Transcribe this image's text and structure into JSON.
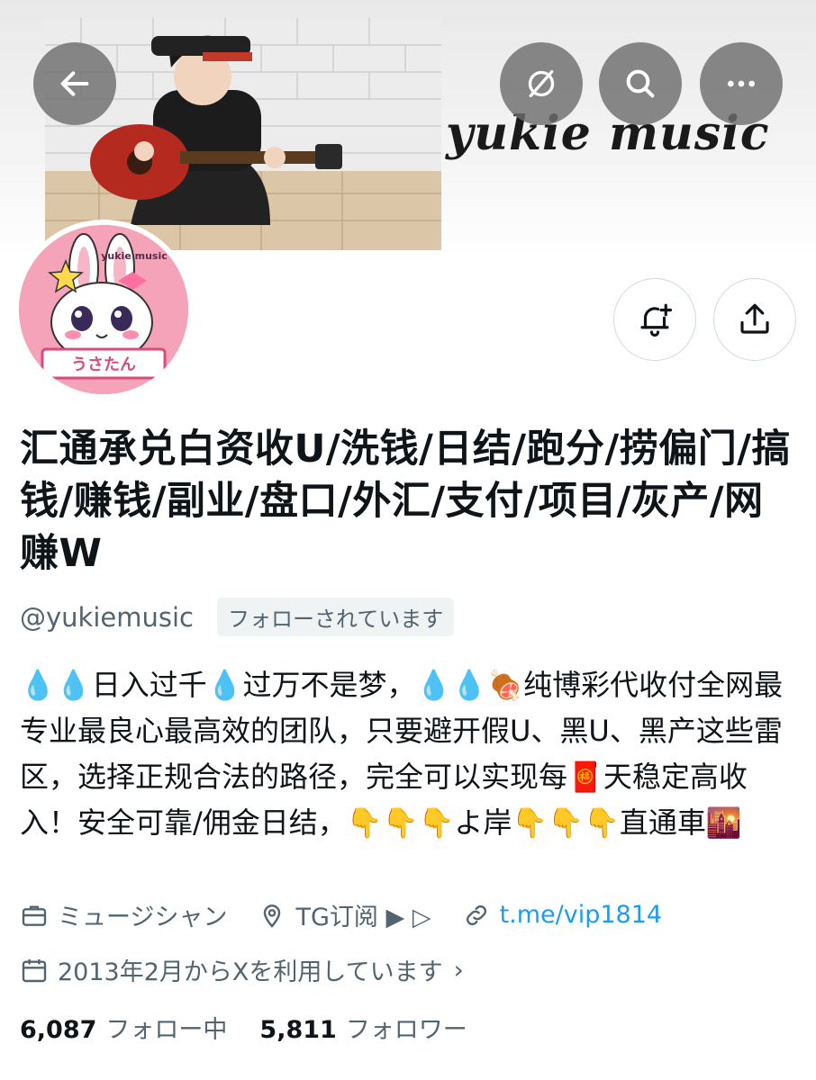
{
  "header": {
    "banner_text": "yukie music",
    "avatar_text_top": "yukie music",
    "avatar_text_bottom": "うさたん"
  },
  "profile": {
    "display_name": "汇通承兑白资收U/洗钱/日结/跑分/捞偏门/搞钱/赚钱/副业/盘口/外汇/支付/项目/灰产/网赚W",
    "handle": "@yukiemusic",
    "follows_you": "フォローされています",
    "bio": "💧💧日入过千💧过万不是梦，💧💧🍖纯博彩代收付全网最专业最良心最高效的团队，只要避开假U、黑U、黑产这些雷区，选择正规合法的路径，完全可以实现每🧧天稳定高收入！安全可靠/佣金日结，👇👇👇よ岸👇👇👇直通車🌇",
    "category": "ミュージシャン",
    "location": "TG订阅 ▶︎ ▷",
    "link": "t.me/vip1814",
    "joined": "2013年2月からXを利用しています",
    "following_count": "6,087",
    "following_label": "フォロー中",
    "followers_count": "5,811",
    "followers_label": "フォロワー"
  },
  "icons": {
    "back": "arrow-left-icon",
    "grok": "grok-icon",
    "search": "search-icon",
    "more": "more-icon",
    "notify": "bell-plus-icon",
    "share": "share-icon",
    "category": "briefcase-icon",
    "location": "location-pin-icon",
    "link": "link-icon",
    "joined": "calendar-icon"
  },
  "colors": {
    "accent": "#1d9bf0",
    "secondary_text": "#536471",
    "primary_text": "#0f1419"
  }
}
